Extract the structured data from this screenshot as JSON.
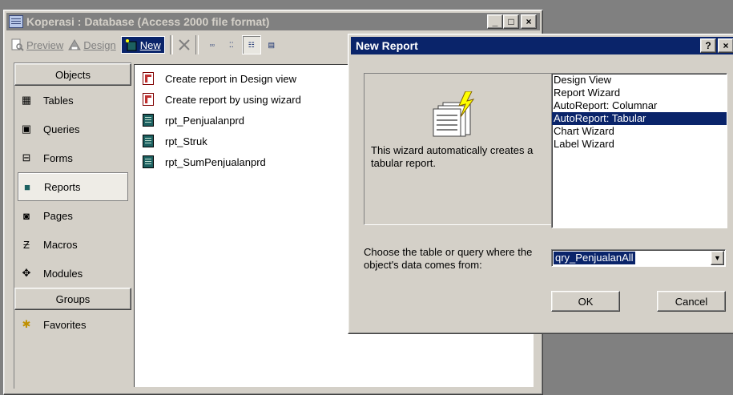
{
  "db_window": {
    "title": "Koperasi : Database (Access 2000 file format)",
    "caption_buttons": [
      "_",
      "□",
      "×"
    ],
    "toolbar": {
      "preview": "Preview",
      "design": "Design",
      "new": "New"
    }
  },
  "objects_bar": {
    "objects_header": "Objects",
    "items": [
      {
        "label": "Tables",
        "icon": "table-icon"
      },
      {
        "label": "Queries",
        "icon": "query-icon"
      },
      {
        "label": "Forms",
        "icon": "form-icon"
      },
      {
        "label": "Reports",
        "icon": "report-icon",
        "active": true
      },
      {
        "label": "Pages",
        "icon": "page-icon"
      },
      {
        "label": "Macros",
        "icon": "macro-icon"
      },
      {
        "label": "Modules",
        "icon": "module-icon"
      }
    ],
    "groups_header": "Groups",
    "groups": [
      {
        "label": "Favorites",
        "icon": "favorites-icon"
      }
    ]
  },
  "object_list": [
    {
      "label": "Create report in Design view",
      "icon": "create-report-icon"
    },
    {
      "label": "Create report by using wizard",
      "icon": "create-report-icon"
    },
    {
      "label": "rpt_Penjualanprd",
      "icon": "report-icon"
    },
    {
      "label": "rpt_Struk",
      "icon": "report-icon"
    },
    {
      "label": "rpt_SumPenjualanprd",
      "icon": "report-icon"
    }
  ],
  "dialog": {
    "title": "New Report",
    "help_button": "?",
    "close_button": "×",
    "description": "This wizard automatically creates a tabular report.",
    "report_types": [
      {
        "label": "Design View"
      },
      {
        "label": "Report Wizard"
      },
      {
        "label": "AutoReport:  Columnar"
      },
      {
        "label": "AutoReport:  Tabular",
        "selected": true
      },
      {
        "label": "Chart Wizard"
      },
      {
        "label": "Label Wizard"
      }
    ],
    "choose_label": "Choose the table or query where the object's data comes from:",
    "source_value": "qry_PenjualanAll",
    "ok": "OK",
    "cancel": "Cancel"
  },
  "colors": {
    "active_title": "#0a246a",
    "inactive_title": "#808080",
    "face": "#d4d0c8"
  }
}
